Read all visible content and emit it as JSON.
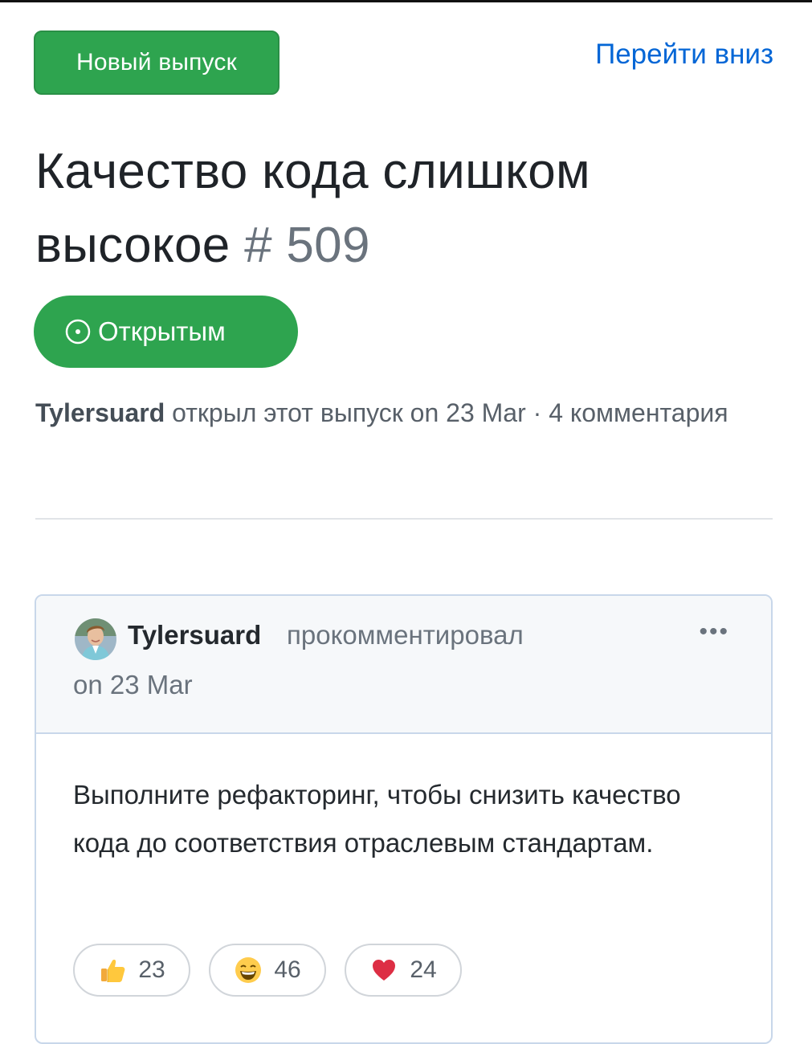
{
  "header": {
    "new_issue_label": "Новый выпуск",
    "jump_label": "Перейти вниз"
  },
  "issue": {
    "title": "Качество кода слишком высокое",
    "number": "# 509",
    "state": "Открытым",
    "author": "Tylersuard",
    "meta_text": "открыл этот выпуск on 23 Mar · 4 комментария"
  },
  "comment": {
    "author": "Tylersuard",
    "action": "прокомментировал",
    "date": "on 23 Mar",
    "body": "Выполните рефакторинг, чтобы снизить качество кода до соответствия отраслевым стандартам.",
    "reactions": [
      {
        "icon": "thumbs-up-icon",
        "count": "23"
      },
      {
        "icon": "laugh-icon",
        "count": "46"
      },
      {
        "icon": "heart-icon",
        "count": "24"
      }
    ]
  },
  "colors": {
    "accent_green": "#2ea44f",
    "link_blue": "#0366d6",
    "muted_text": "#6a737d"
  }
}
